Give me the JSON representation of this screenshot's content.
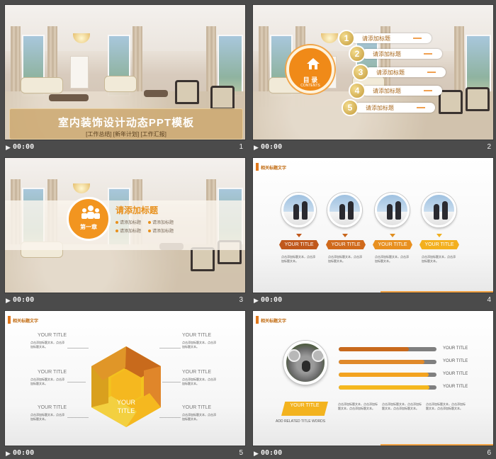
{
  "footer": {
    "time": "00:00",
    "play_icon": "play-icon"
  },
  "slides": [
    {
      "num": "1",
      "title": "室内装饰设计动态PPT模板",
      "subtitle": "[工作总结]  [新年计划]  [工作汇报]"
    },
    {
      "num": "2",
      "toc_title": "目 录",
      "toc_sub": "CONTENTS",
      "items": [
        {
          "n": "1",
          "label": "请添加标题"
        },
        {
          "n": "2",
          "label": "请添加标题"
        },
        {
          "n": "3",
          "label": "请添加标题"
        },
        {
          "n": "4",
          "label": "请添加标题"
        },
        {
          "n": "5",
          "label": "请添加标题"
        }
      ]
    },
    {
      "num": "3",
      "chapter": "第一章",
      "title": "请添加标题",
      "items": [
        "请添加标题",
        "请添加标题",
        "请添加标题",
        "请添加标题"
      ]
    },
    {
      "num": "4",
      "header": "相关标题文字",
      "tags": [
        "YOUR TITLE",
        "YOUR TITLE",
        "YOUR TITLE",
        "YOUR TITLE"
      ],
      "text": "点击添加标题文本，点击添加标题文本。"
    },
    {
      "num": "5",
      "header": "相关标题文字",
      "center": "YOUR TITLE",
      "left_titles": [
        "YOUR TITLE",
        "YOUR TITLE",
        "YOUR TITLE"
      ],
      "right_titles": [
        "YOUR TITLE",
        "YOUR TITLE",
        "YOUR TITLE"
      ],
      "text": "点击添加标题文本，点击添加标题文本。"
    },
    {
      "num": "6",
      "header": "相关标题文字",
      "bars": [
        {
          "label": "YOUR TITLE",
          "fraction": 0.72,
          "color": "#c8691c"
        },
        {
          "label": "YOUR TITLE",
          "fraction": 0.88,
          "color": "#e0892a"
        },
        {
          "label": "YOUR TITLE",
          "fraction": 0.92,
          "color": "#f3a31f"
        },
        {
          "label": "YOUR TITLE",
          "fraction": 0.93,
          "color": "#f5b81f"
        }
      ],
      "tag": "YOUR TITLE",
      "sub": "ADD RELATED TITLE WORDS",
      "text": "点击添加标题文本，点击添加标题文本，点击添加标题文本。"
    }
  ],
  "colors": {
    "accent": "#f0a000",
    "orange": "#e0781c",
    "gold": "#c49a3a"
  }
}
